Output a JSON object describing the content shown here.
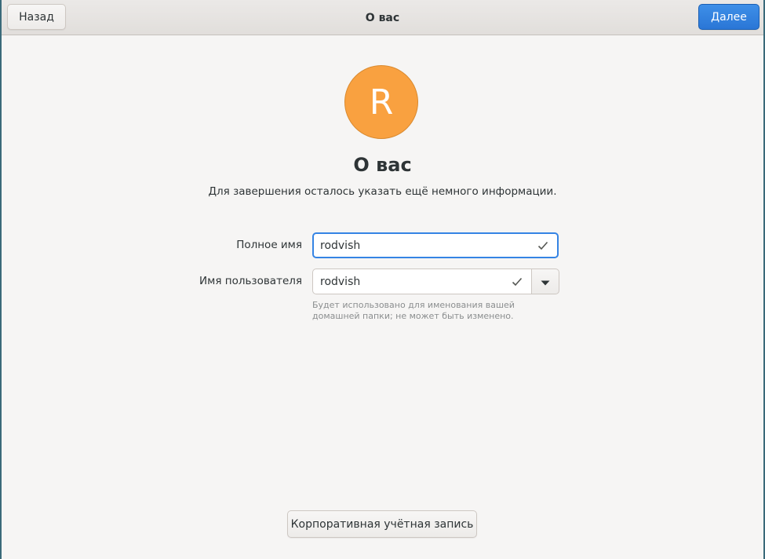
{
  "header": {
    "back_label": "Назад",
    "title": "О вас",
    "next_label": "Далее",
    "accent_color": "#3584e4"
  },
  "avatar": {
    "initial": "R",
    "color": "#f9a140"
  },
  "main": {
    "title": "О вас",
    "subtitle": "Для завершения осталось указать ещё немного информации."
  },
  "form": {
    "fullname_label": "Полное имя",
    "fullname_value": "rodvish",
    "username_label": "Имя пользователя",
    "username_value": "rodvish",
    "username_hint": "Будет использовано для именования вашей домашней папки; не может быть изменено.",
    "valid_icon": "check-icon",
    "dropdown_icon": "triangle-down-icon"
  },
  "footer": {
    "enterprise_label": "Корпоративная учётная запись"
  }
}
